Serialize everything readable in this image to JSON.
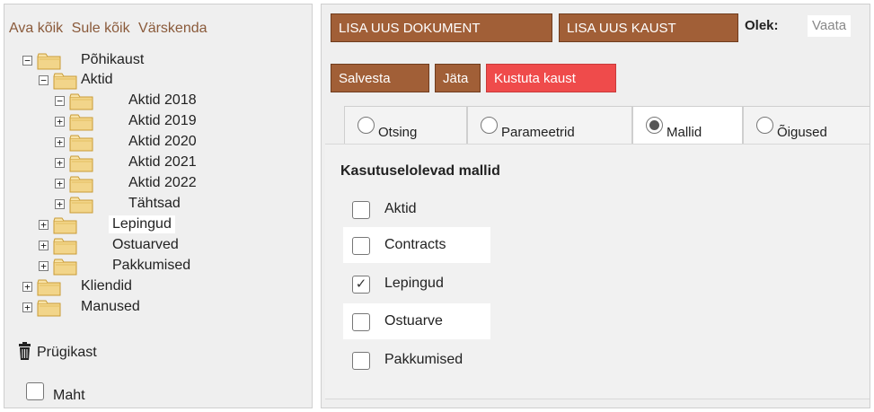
{
  "tree": {
    "actions": [
      "Ava kõik",
      "Sule kõik",
      "Värskenda"
    ],
    "nodes": [
      {
        "label": "Põhikaust",
        "expander": "−"
      },
      {
        "label": "Aktid",
        "expander": "−"
      },
      {
        "label": "Aktid 2018",
        "expander": "−"
      },
      {
        "label": "Aktid 2019",
        "expander": "+"
      },
      {
        "label": "Aktid 2020",
        "expander": "+"
      },
      {
        "label": "Aktid 2021",
        "expander": "+"
      },
      {
        "label": "Aktid 2022",
        "expander": "+"
      },
      {
        "label": "Tähtsad",
        "expander": "+"
      },
      {
        "label": "Lepingud",
        "expander": "+",
        "selected": true
      },
      {
        "label": "Ostuarved",
        "expander": "+"
      },
      {
        "label": "Pakkumised",
        "expander": "+"
      },
      {
        "label": "Kliendid",
        "expander": "+"
      },
      {
        "label": "Manused",
        "expander": "+"
      }
    ],
    "trash_label": "Prügikast",
    "maht_label": "Maht",
    "trash_icon": "trash-icon",
    "folder_icon": "folder-icon",
    "folder_color": "#f2d58a"
  },
  "toolbar": {
    "add_document": "LISA UUS DOKUMENT",
    "add_folder": "LISA UUS KAUST",
    "status_label": "Olek:",
    "status_value": "Vaata",
    "save": "Salvesta",
    "leave": "Jäta",
    "delete_folder": "Kustuta kaust",
    "button_color": "#a15f37",
    "danger_color": "#ef4b4b"
  },
  "tabs": [
    {
      "label": "Otsing",
      "selected": false
    },
    {
      "label": "Parameetrid",
      "selected": false
    },
    {
      "label": "Mallid",
      "selected": true
    },
    {
      "label": "Õigused",
      "selected": false
    }
  ],
  "templates": {
    "title": "Kasutuselolevad mallid",
    "items": [
      {
        "label": "Aktid",
        "checked": false
      },
      {
        "label": "Contracts",
        "checked": false
      },
      {
        "label": "Lepingud",
        "checked": true
      },
      {
        "label": "Ostuarve",
        "checked": false
      },
      {
        "label": "Pakkumised",
        "checked": false
      }
    ]
  }
}
